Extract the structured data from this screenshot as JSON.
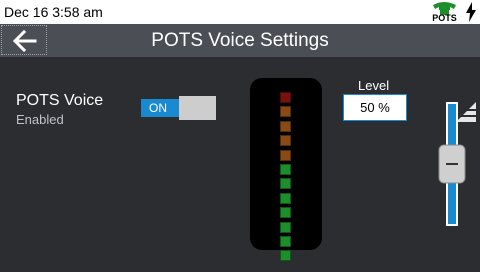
{
  "status_bar": {
    "time": "Dec 16 3:58 am",
    "pots_label": "POTS",
    "icons": [
      "pots-phone-icon",
      "charging-bolt-icon"
    ]
  },
  "header": {
    "title": "POTS Voice Settings",
    "back_icon": "arrow-left-icon"
  },
  "pots_voice": {
    "label": "POTS Voice",
    "state_text": "Enabled",
    "toggle_label": "ON",
    "toggle_on": true
  },
  "meter": {
    "segment_count": 12,
    "lit_fraction": 1.0,
    "segment_colors": [
      "#7a1010",
      "#8a4a14",
      "#8a4a14",
      "#8a4a14",
      "#8a4a14",
      "#1d8f2a",
      "#1d8f2a",
      "#1d8f2a",
      "#1d8f2a",
      "#1d8f2a",
      "#1d8f2a",
      "#1d8f2a"
    ]
  },
  "level": {
    "label": "Level",
    "value_text": "50 %",
    "value": 50
  },
  "colors": {
    "accent": "#1a8ad0",
    "background": "#2b2d31",
    "title_bar": "#4b4f55"
  }
}
